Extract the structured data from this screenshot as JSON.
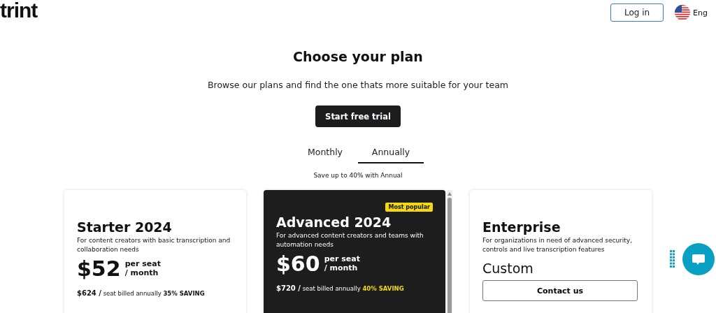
{
  "header": {
    "logo": "trint",
    "login": "Log in",
    "language": "Eng"
  },
  "hero": {
    "title": "Choose your plan",
    "subtitle": "Browse our plans and find the one thats more suitable for your team",
    "cta": "Start free trial"
  },
  "billing_tabs": [
    {
      "label": "Monthly",
      "selected": false
    },
    {
      "label": "Annually",
      "selected": true
    }
  ],
  "billing_note": "Save up to 40% with Annual",
  "plans": [
    {
      "kind": "priced",
      "featured": false,
      "name": "Starter 2024",
      "description": "For content creators with basic transcription and collaboration needs",
      "price": "$52",
      "unit_top": "per seat",
      "unit_bottom": "/ month",
      "annual_price": "$624 /",
      "annual_text": "seat billed annually",
      "saving": "35% SAVING"
    },
    {
      "kind": "priced",
      "featured": true,
      "badge": "Most popular",
      "name": "Advanced 2024",
      "description": "For advanced content creators and teams with automation needs",
      "price": "$60",
      "unit_top": "per seat",
      "unit_bottom": "/ month",
      "annual_price": "$720 /",
      "annual_text": "seat billed annually",
      "saving": "40% SAVING"
    },
    {
      "kind": "custom",
      "featured": false,
      "name": "Enterprise",
      "description": "For organizations in need of advanced security, controls and live transcription features",
      "price": "Custom",
      "button": "Contact us"
    }
  ]
}
